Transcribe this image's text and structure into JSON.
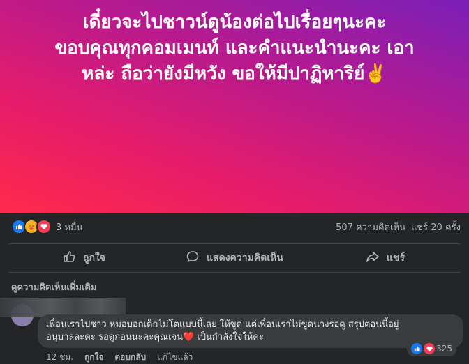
{
  "post": {
    "banner_lines": [
      "เดี๋ยวจะไปชาวน์ดูน้องต่อไปเรื่อยๆนะคะ",
      "ขอบคุณทุกคอมเมนท์ และคำแนะนำนะคะ เอา",
      "หล่ะ ถือว่ายังมีหวัง ขอให้มีปาฏิหาริย์✌️"
    ],
    "colors": {
      "gradient_top": "#7a1fb8",
      "gradient_bottom": "#ff2a4a"
    }
  },
  "stats": {
    "reaction_icons": [
      "like-icon",
      "care-icon",
      "love-icon"
    ],
    "reaction_count": "3 หมื่น",
    "comments": "507 ความคิดเห็น",
    "shares": "แชร์ 20 ครั้ง"
  },
  "actions": {
    "like": "ถูกใจ",
    "comment": "แสดงความคิดเห็น",
    "share": "แชร์"
  },
  "comments_section": {
    "more_comments": "ดูความคิดเห็นเพิ่มเติม",
    "comment": {
      "line1": "เพื่อนเราไปชาว หมอบอกเด็กไม่โตแบบนี้เลย ให้ขูด แต่เพื่อนเราไม่ขูดนางรอดู สรุปตอนนี้อยู่",
      "line2": "อนุบาลละคะ รอดูก่อนนะคะคุณเจน❤️ เป็นกำลังใจให้คะ",
      "reaction_count": "325",
      "time": "12 ชม.",
      "like": "ถูกใจ",
      "reply": "ตอบกลับ",
      "edit": "แก้ไขแล้ว"
    }
  }
}
